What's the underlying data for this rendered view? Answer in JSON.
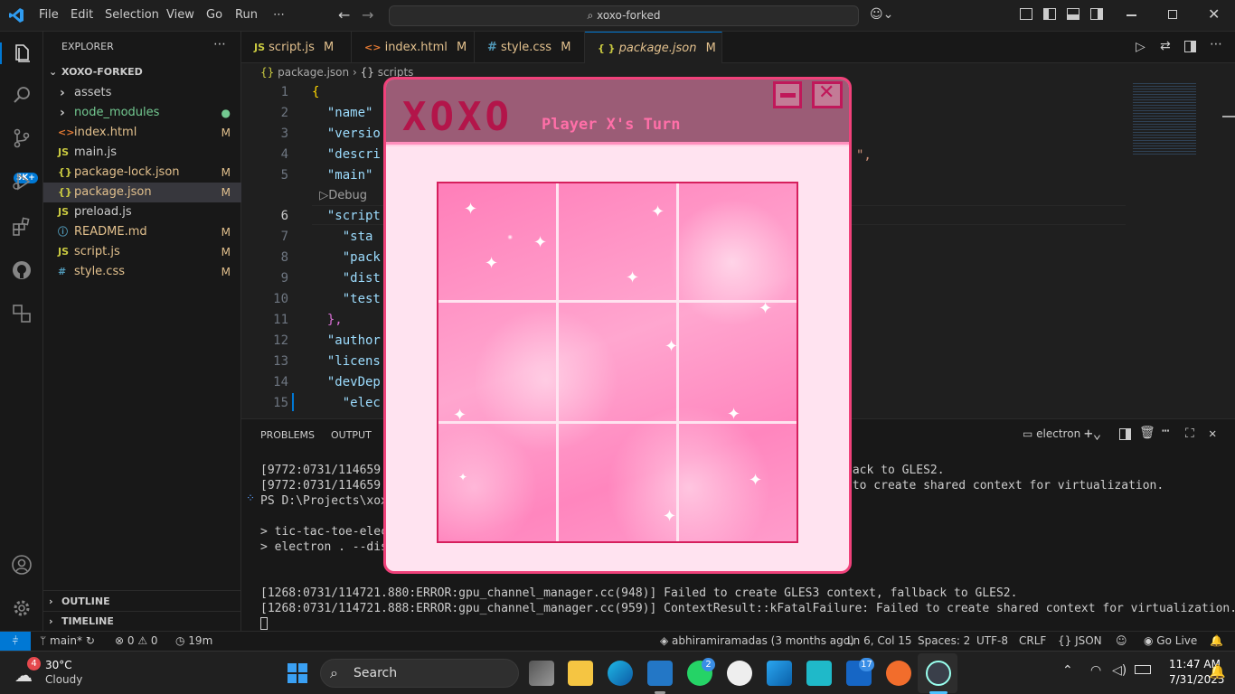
{
  "titlebar": {
    "menu": [
      "File",
      "Edit",
      "Selection",
      "View",
      "Go",
      "Run",
      "⋯"
    ],
    "search": "xoxo-forked",
    "copilot_label": "⌂"
  },
  "activity": {
    "badge_count": "5K+"
  },
  "explorer": {
    "header": "EXPLORER",
    "more": "⋯",
    "root": "XOXO-FORKED",
    "items": [
      {
        "name": "assets",
        "type": "folder",
        "status": "",
        "color": "#cccccc"
      },
      {
        "name": "node_modules",
        "type": "folder",
        "status": "●",
        "color": "#73c991"
      },
      {
        "name": "index.html",
        "type": "html",
        "status": "M",
        "color": "#e2c08d"
      },
      {
        "name": "main.js",
        "type": "js",
        "status": "",
        "color": "#cccccc"
      },
      {
        "name": "package-lock.json",
        "type": "json",
        "status": "M",
        "color": "#e2c08d"
      },
      {
        "name": "package.json",
        "type": "json",
        "status": "M",
        "color": "#e2c08d"
      },
      {
        "name": "preload.js",
        "type": "js",
        "status": "",
        "color": "#cccccc"
      },
      {
        "name": "README.md",
        "type": "md",
        "status": "M",
        "color": "#e2c08d"
      },
      {
        "name": "script.js",
        "type": "js",
        "status": "M",
        "color": "#e2c08d"
      },
      {
        "name": "style.css",
        "type": "css",
        "status": "M",
        "color": "#e2c08d"
      }
    ],
    "outline": "OUTLINE",
    "timeline": "TIMELINE"
  },
  "tabs": [
    {
      "icon": "JS",
      "label": "script.js",
      "status": "M"
    },
    {
      "icon": "<>",
      "label": "index.html",
      "status": "M"
    },
    {
      "icon": "#",
      "label": "style.css",
      "status": "M"
    },
    {
      "icon": "{ }",
      "label": "package.json",
      "status": "M"
    }
  ],
  "breadcrumb": {
    "file": "package.json",
    "sep": "›",
    "node": "scripts"
  },
  "editor": {
    "lines": [
      {
        "n": "1",
        "text": "{"
      },
      {
        "n": "2",
        "text": "  \"name\""
      },
      {
        "n": "3",
        "text": "  \"versio"
      },
      {
        "n": "4",
        "text": "  \"descri"
      },
      {
        "n": "5",
        "text": "  \"main\""
      },
      {
        "n": "",
        "text": "  ▷Debug"
      },
      {
        "n": "6",
        "text": "  \"script"
      },
      {
        "n": "7",
        "text": "    \"sta"
      },
      {
        "n": "8",
        "text": "    \"pack"
      },
      {
        "n": "9",
        "text": "    \"dist"
      },
      {
        "n": "10",
        "text": "    \"test"
      },
      {
        "n": "11",
        "text": "  },"
      },
      {
        "n": "12",
        "text": "  \"author"
      },
      {
        "n": "13",
        "text": "  \"licens"
      },
      {
        "n": "14",
        "text": "  \"devDep"
      },
      {
        "n": "15",
        "text": "    \"elec"
      }
    ],
    "line4_tail": "\","
  },
  "panel": {
    "tabs": [
      "PROBLEMS",
      "OUTPUT"
    ],
    "terminal_name": "electron",
    "lines": [
      "[9772:0731/114659.46",
      "[9772:0731/114659.46",
      "PS D:\\Projects\\xoxo-",
      "",
      "> tic-tac-toe-electr",
      "> electron . --disab",
      "",
      "",
      "[1268:0731/114721.880:ERROR:gpu_channel_manager.cc(948)] Failed to create GLES3 context, fallback to GLES2.",
      "[1268:0731/114721.888:ERROR:gpu_channel_manager.cc(959)] ContextResult::kFatalFailure: Failed to create shared context for virtualization."
    ],
    "tail1": "back to GLES2.",
    "tail2": " to create shared context for virtualization."
  },
  "xoxo": {
    "logo": "XOXO",
    "turn": "Player X's Turn",
    "min_label": "—",
    "close_label": "✕"
  },
  "statusbar": {
    "remote": "⫩",
    "branch": "main*",
    "sync": "↻",
    "errors": "0",
    "warnings": "0",
    "time": "19m",
    "blame": "abhiramiramadas (3 months ago)",
    "position": "Ln 6, Col 15",
    "spaces": "Spaces: 2",
    "encoding": "UTF-8",
    "eol": "CRLF",
    "language": "{} JSON",
    "golive": "Go Live"
  },
  "taskbar": {
    "weather_temp": "30°C",
    "weather_desc": "Cloudy",
    "weather_badge": "4",
    "search": "Search",
    "whatsapp_badge": "2",
    "outlook_badge": "17",
    "time": "11:47 AM",
    "date": "7/31/2025"
  }
}
